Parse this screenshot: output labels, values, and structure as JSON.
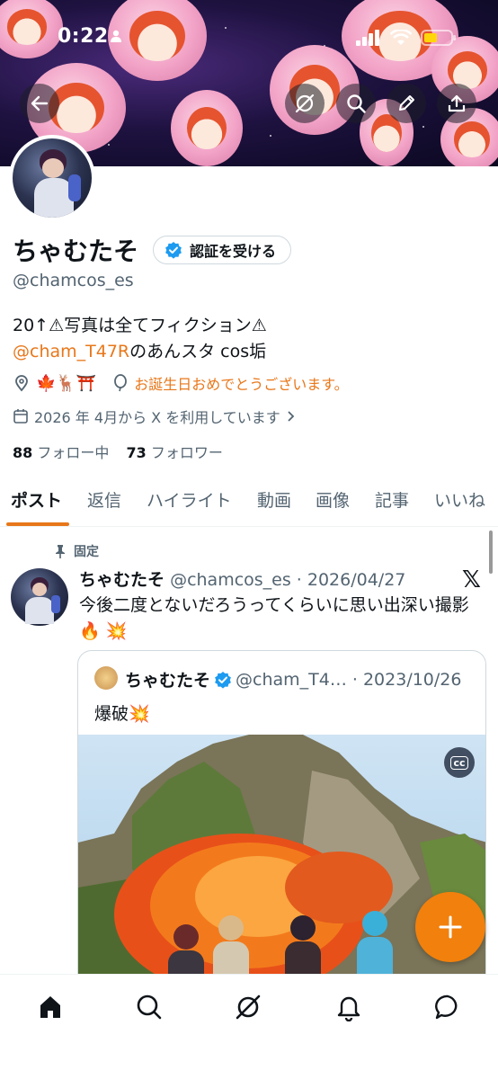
{
  "status_bar": {
    "time": "0:22"
  },
  "profile": {
    "name": "ちゃむたそ",
    "verify_label": "認証を受ける",
    "handle": "@chamcos_es",
    "bio_line1": "20↑⚠写真は全てフィクション⚠",
    "bio_mention": "@cham_T47R",
    "bio_line2_rest": "のあんスタ cos垢",
    "location_emoji": "🍁🦌⛩️",
    "birthday_text": "お誕生日おめでとうございます。",
    "joined_text": "2026 年 4月から X を利用しています",
    "following_count": "88",
    "following_label": "フォロー中",
    "followers_count": "73",
    "followers_label": "フォロワー"
  },
  "tabs": [
    "ポスト",
    "返信",
    "ハイライト",
    "動画",
    "画像",
    "記事",
    "いいね"
  ],
  "post": {
    "pinned_label": "固定",
    "author": "ちゃむたそ",
    "handle_date": "@chamcos_es · 2026/04/27",
    "text": "今後二度とないだろうってくらいに思い出深い撮影🔥 💥",
    "quote": {
      "author": "ちゃむたそ",
      "handle_date": "@cham_T4… · 2023/10/26",
      "text": "爆破💥",
      "cc_label": "cc"
    }
  },
  "colors": {
    "accent": "#e8771a",
    "fab": "#f2800c",
    "verified": "#1d9bf0"
  },
  "icons": {
    "back": "arrow-left-icon",
    "search": "search-icon",
    "edit": "pencil-icon",
    "share": "share-icon",
    "grok": "grok-icon",
    "home": "home-icon",
    "notifications": "bell-icon",
    "messages": "message-icon"
  }
}
